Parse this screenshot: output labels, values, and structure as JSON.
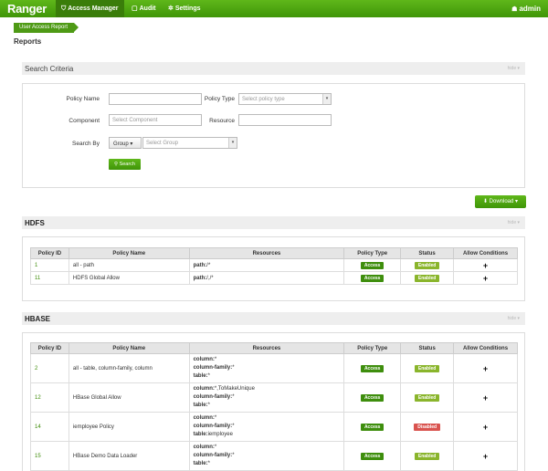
{
  "nav": {
    "brand": "Ranger",
    "items": [
      {
        "label": "Access Manager",
        "active": true
      },
      {
        "label": "Audit",
        "active": false
      },
      {
        "label": "Settings",
        "active": false
      }
    ],
    "user": "admin"
  },
  "breadcrumb": "User Access Report",
  "page_title": "Reports",
  "search": {
    "title": "Search Criteria",
    "hide": "hide",
    "policy_name_label": "Policy Name",
    "policy_name_value": "",
    "policy_type_label": "Policy Type",
    "policy_type_placeholder": "Select policy type",
    "component_label": "Component",
    "component_placeholder": "Select Component",
    "resource_label": "Resource",
    "resource_value": "",
    "search_by_label": "Search By",
    "search_by_option": "Group",
    "group_placeholder": "Select Group",
    "search_button": "Search"
  },
  "download_button": "Download",
  "columns": [
    "Policy ID",
    "Policy Name",
    "Resources",
    "Policy Type",
    "Status",
    "Allow Conditions"
  ],
  "hdfs": {
    "title": "HDFS",
    "hide": "hide",
    "rows": [
      {
        "id": "1",
        "name": "all - path",
        "res_key": "path:",
        "res_val": "/*",
        "type": "Access",
        "status": "Enabled",
        "cond": "+"
      },
      {
        "id": "11",
        "name": "HDFS Global Allow",
        "res_key": "path:",
        "res_val": "/,/*",
        "type": "Access",
        "status": "Enabled",
        "cond": "+"
      }
    ]
  },
  "hbase": {
    "title": "HBASE",
    "hide": "hide",
    "rows": [
      {
        "id": "2",
        "name": "all - table, column-family, column",
        "r1k": "column:",
        "r1v": "*",
        "r2k": "column-family:",
        "r2v": "*",
        "r3k": "table:",
        "r3v": "*",
        "type": "Access",
        "status": "Enabled",
        "cond": "+"
      },
      {
        "id": "12",
        "name": "HBase Global Allow",
        "r1k": "column:",
        "r1v": "*,ToMakeUnique",
        "r2k": "column-family:",
        "r2v": "*",
        "r3k": "table:",
        "r3v": "*",
        "type": "Access",
        "status": "Enabled",
        "cond": "+"
      },
      {
        "id": "14",
        "name": "iemployee Policy",
        "r1k": "column:",
        "r1v": "*",
        "r2k": "column-family:",
        "r2v": "*",
        "r3k": "table:",
        "r3v": "iemployee",
        "type": "Access",
        "status": "Disabled",
        "cond": "+"
      },
      {
        "id": "15",
        "name": "HBase Demo Data Loader",
        "r1k": "column:",
        "r1v": "*",
        "r2k": "column-family:",
        "r2v": "*",
        "r3k": "table:",
        "r3v": "*",
        "type": "Access",
        "status": "Enabled",
        "cond": "+"
      }
    ]
  }
}
